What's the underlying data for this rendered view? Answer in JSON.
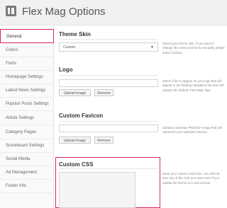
{
  "header": {
    "title": "Flex Mag Options",
    "logo_icon": "options-panel-icon"
  },
  "sidebar": {
    "items": [
      {
        "label": "General",
        "active": true
      },
      {
        "label": "Colors"
      },
      {
        "label": "Fonts"
      },
      {
        "label": "Homepage Settings"
      },
      {
        "label": "Latest News Settings"
      },
      {
        "label": "Popular Posts Settings"
      },
      {
        "label": "Article Settings"
      },
      {
        "label": "Category Pages"
      },
      {
        "label": "Scoreboard Settings"
      },
      {
        "label": "Social Media"
      },
      {
        "label": "Ad Management"
      },
      {
        "label": "Footer Info"
      }
    ]
  },
  "sections": {
    "theme_skin": {
      "title": "Theme Skin",
      "selected": "Custom",
      "description": "Select your theme skin. If you want to change the colors and fonts manually, please select Custom."
    },
    "logo": {
      "title": "Logo",
      "upload_label": "Upload Image",
      "remove_label": "Remove",
      "description": "Select a file to appear as your logo that will appear in the floating navigation bar and will replace the default \"Flex Mag\" logo."
    },
    "favicon": {
      "title": "Custom Favicon",
      "upload_label": "Upload Image",
      "remove_label": "Remove",
      "description": "Upload a 16x16px PNG/GIF image that will represent your website's favicon."
    },
    "custom_css": {
      "title": "Custom CSS",
      "description": "Enter your custom CSS here. You will not lose any of the CSS you enter here if you update the theme to a new version."
    }
  },
  "colors": {
    "highlight": "#d4276a"
  }
}
